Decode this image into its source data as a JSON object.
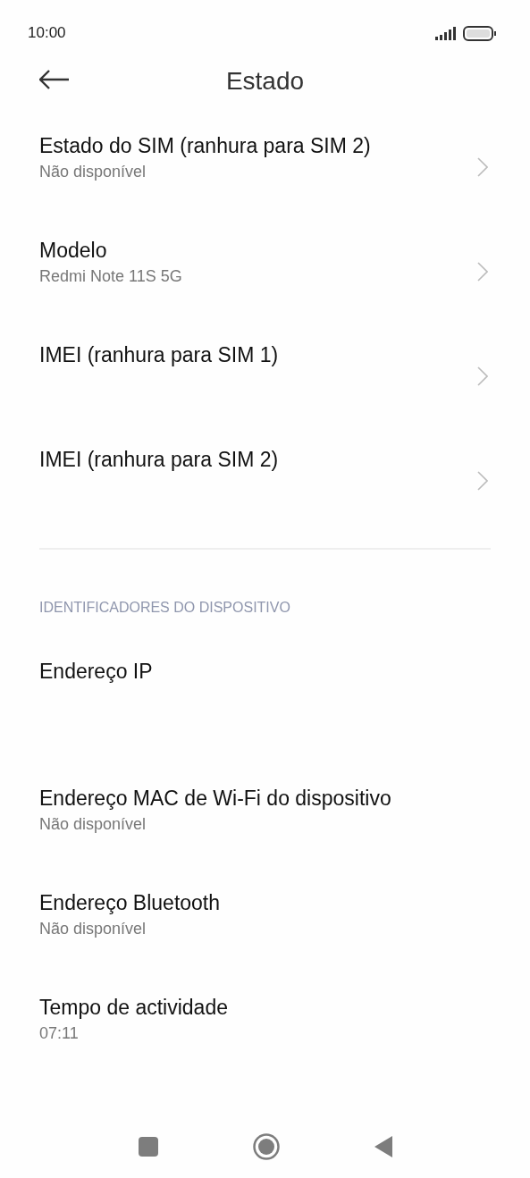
{
  "status_bar": {
    "time": "10:00"
  },
  "header": {
    "title": "Estado"
  },
  "sections": [
    {
      "items": [
        {
          "title": "Estado do SIM (ranhura para SIM 2)",
          "subtitle": "Não disponível",
          "has_chevron": true
        },
        {
          "title": "Modelo",
          "subtitle": "Redmi Note 11S 5G",
          "has_chevron": true
        },
        {
          "title": "IMEI (ranhura para SIM 1)",
          "has_chevron": true
        },
        {
          "title": "IMEI (ranhura para SIM 2)",
          "has_chevron": true
        }
      ]
    },
    {
      "label": "IDENTIFICADORES DO DISPOSITIVO",
      "items": [
        {
          "title": "Endereço IP",
          "has_chevron": false
        },
        {
          "title": "Endereço MAC de Wi-Fi do dispositivo",
          "subtitle": "Não disponível",
          "has_chevron": false
        },
        {
          "title": "Endereço Bluetooth",
          "subtitle": "Não disponível",
          "has_chevron": false
        },
        {
          "title": "Tempo de actividade",
          "subtitle": "07:11",
          "has_chevron": false
        }
      ]
    }
  ]
}
